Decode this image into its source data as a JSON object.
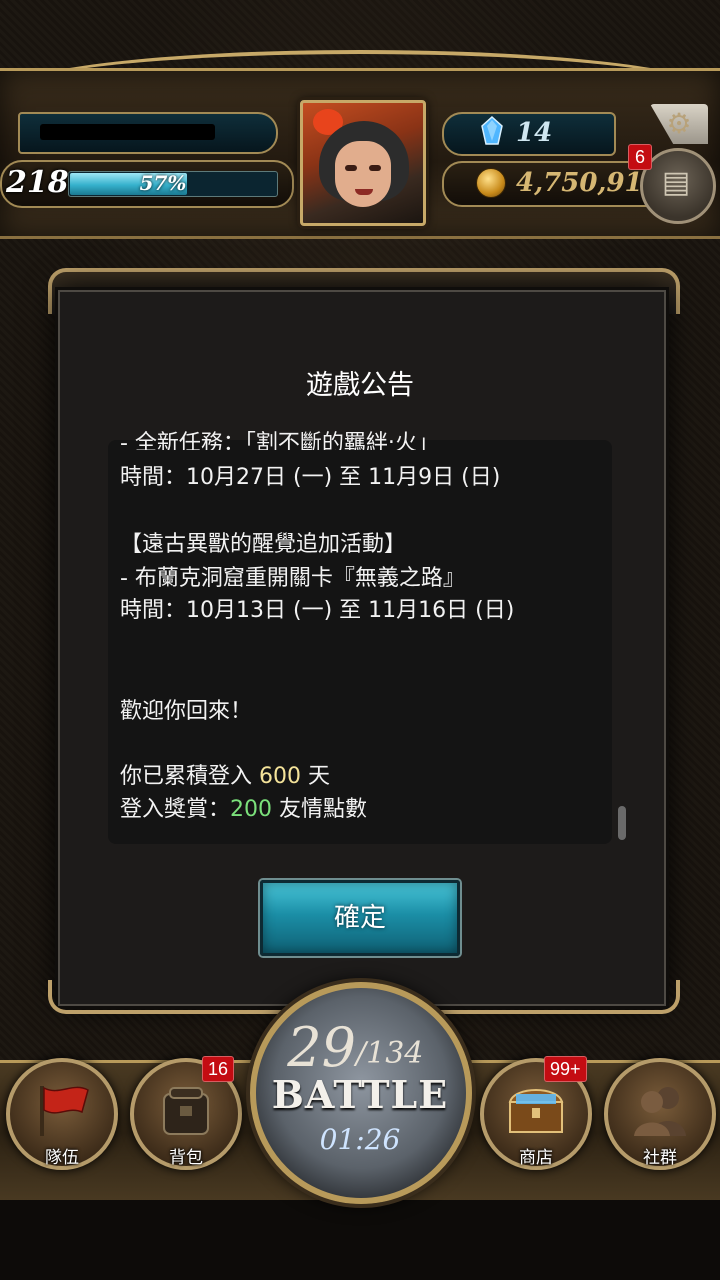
{
  "hud": {
    "level": "218",
    "exp_percent": "57%",
    "exp_fraction": 0.57,
    "gems": "14",
    "gold": "4,750,918",
    "menu_badge": "6"
  },
  "dialog": {
    "title": "遊戲公告",
    "lines": [
      "- 全新任務：「割不斷的羈絆‧火」",
      "時間：10月27日 (一) 至 11月9日 (日)",
      "",
      "【遠古異獸的醒覺追加活動】",
      "- 布蘭克洞窟重開關卡『無義之路』",
      "時間：10月13日 (一) 至 11月16日 (日)",
      "",
      "",
      "歡迎你回來！",
      "",
      "你已累積登入",
      "登入獎賞："
    ],
    "login_days_prefix": "你已累積登入 ",
    "login_days": "600",
    "login_days_suffix": " 天",
    "reward_prefix": "登入獎賞：",
    "reward_amount": "200",
    "reward_suffix": " 友情點數",
    "confirm_label": "確定"
  },
  "nav": {
    "team_label": "隊伍",
    "bag_label": "背包",
    "bag_badge": "16",
    "shop_label": "商店",
    "shop_badge": "99+",
    "social_label": "社群",
    "battle_current": "29",
    "battle_total": "/134",
    "battle_word": "BATTLE",
    "battle_timer": "01:26"
  }
}
